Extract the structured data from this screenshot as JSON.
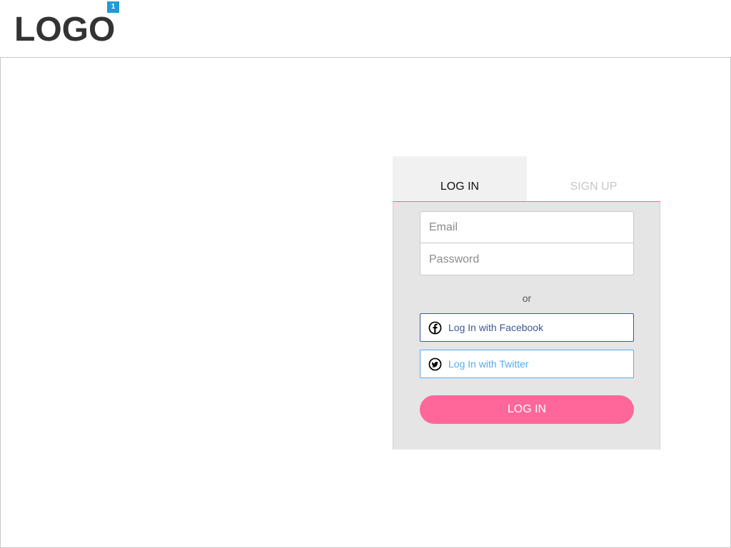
{
  "header": {
    "logo_text": "LOGO",
    "badge_count": "1"
  },
  "auth": {
    "tabs": [
      {
        "label": "LOG IN",
        "active": true
      },
      {
        "label": "SIGN UP",
        "active": false
      }
    ],
    "email_placeholder": "Email",
    "email_value": "",
    "password_placeholder": "Password",
    "password_value": "",
    "or_text": "or",
    "facebook_label": "Log In with Facebook",
    "twitter_label": "Log In with Twitter",
    "submit_label": "LOG IN"
  },
  "colors": {
    "accent": "#ff6699",
    "badge": "#1e9bd7",
    "facebook": "#3b5998",
    "twitter": "#55acee",
    "panel_bg": "#e5e5e5",
    "active_tab_bg": "#f1f1f1"
  },
  "icons": {
    "logo_badge": "notification-badge",
    "facebook": "facebook-icon",
    "twitter": "twitter-icon"
  }
}
